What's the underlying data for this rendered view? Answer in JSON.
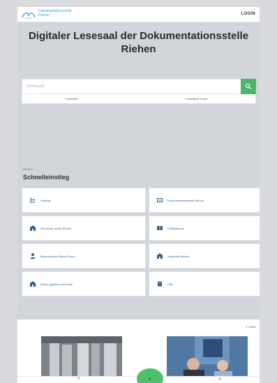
{
  "header": {
    "brand_line1": "Dokumentationsstelle",
    "brand_line2": "Riehen",
    "login_label": "LOGIN"
  },
  "page": {
    "title": "Digitaler Lesesaal der Dokumentationsstelle Riehen"
  },
  "search": {
    "placeholder": "Suchbegriff",
    "link_left": "+ Suchfilter",
    "link_right": "+ erweiterte Suche"
  },
  "quickstart": {
    "subheading": "INHALT",
    "title": "Schnelleinstieg",
    "tiles": [
      {
        "label": "Ortsteile",
        "icon": "hierarchy-icon"
      },
      {
        "label": "Dokumentationsstelle Riehen",
        "icon": "archive-box-icon"
      },
      {
        "label": "Gemeinde-archiv Riehen",
        "icon": "building-icon"
      },
      {
        "label": "Publikationen",
        "icon": "books-icon"
      },
      {
        "label": "Museumsfoto Riehen Druck",
        "icon": "person-icon"
      },
      {
        "label": "Zeitschrift Riehen",
        "icon": "building-icon"
      },
      {
        "label": "Riehen gestern und heute",
        "icon": "building-icon"
      },
      {
        "label": "Hilfe",
        "icon": "book-icon"
      }
    ]
  },
  "teaser": {
    "count_label": "2 Treffer"
  },
  "bottom_nav": {
    "help_label": "?",
    "menu_label": "≡"
  },
  "colors": {
    "accent_green": "#4cb56b",
    "link_blue": "#2f5f8a",
    "brand_blue": "#3aa0d8"
  }
}
